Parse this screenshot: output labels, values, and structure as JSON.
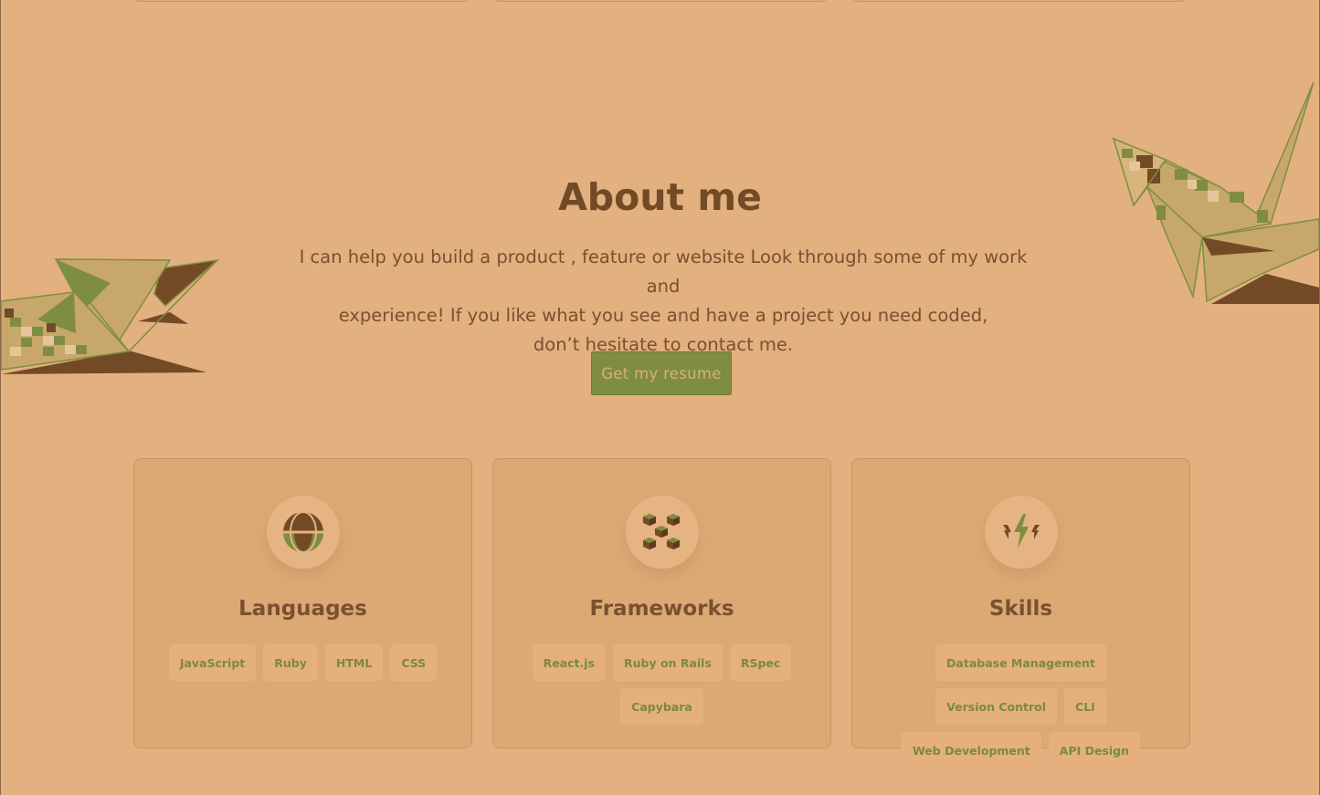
{
  "about": {
    "title": "About me",
    "intro_lines": [
      "I can help you build a product , feature or website Look through some of my work and",
      "experience! If you like what you see and have a project you need coded,",
      "don’t hesitate to contact me."
    ],
    "resume_button": "Get my resume"
  },
  "cards": [
    {
      "title": "Languages",
      "icon": "globe-icon",
      "tags": [
        "JavaScript",
        "Ruby",
        "HTML",
        "CSS"
      ]
    },
    {
      "title": "Frameworks",
      "icon": "cubes-icon",
      "tags": [
        "React.js",
        "Ruby on Rails",
        "RSpec",
        "Capybara"
      ]
    },
    {
      "title": "Skills",
      "icon": "lightning-icon",
      "tags": [
        "Database Management",
        "Version Control",
        "CLI",
        "Web Development",
        "API Design"
      ]
    }
  ],
  "colors": {
    "background": "#e3b07f",
    "card": "#dca874",
    "brown": "#734a26",
    "olive": "#7e8d42",
    "tan": "#c7a86a"
  }
}
